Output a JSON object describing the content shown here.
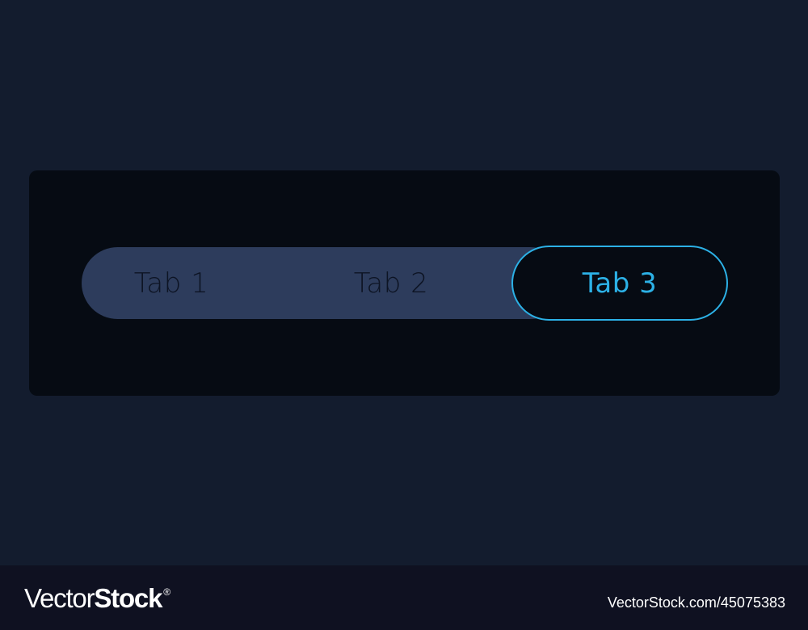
{
  "tabs": {
    "items": [
      {
        "label": "Tab 1",
        "active": false
      },
      {
        "label": "Tab 2",
        "active": false
      },
      {
        "label": "Tab 3",
        "active": true
      }
    ]
  },
  "footer": {
    "brand_light": "Vector",
    "brand_bold": "Stock",
    "brand_mark": "®",
    "stock_id": "VectorStock.com/45075383"
  },
  "colors": {
    "page_bg": "#131c2e",
    "card_bg": "#060b13",
    "track_bg": "#2d3c5c",
    "inactive_text": "#0d1424",
    "accent": "#2cb1e6",
    "footer_bg": "#0f1121"
  }
}
